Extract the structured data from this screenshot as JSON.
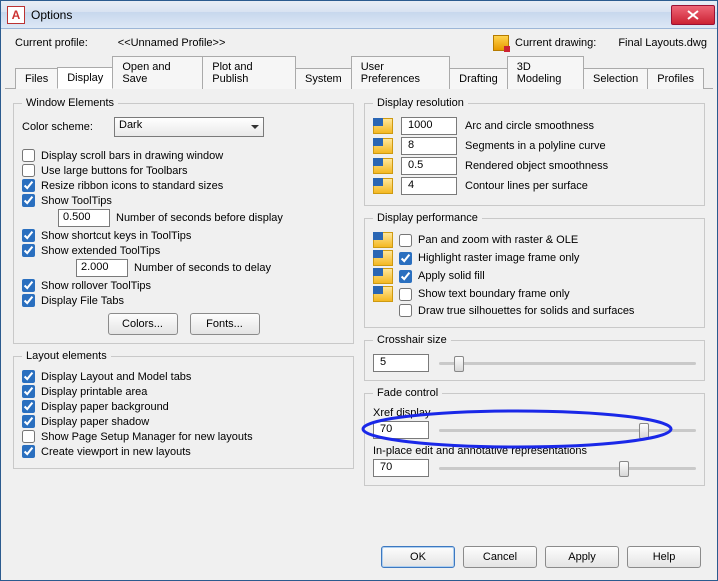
{
  "window": {
    "title": "Options"
  },
  "header": {
    "profile_label": "Current profile:",
    "profile_value": "<<Unnamed Profile>>",
    "drawing_label": "Current drawing:",
    "drawing_value": "Final Layouts.dwg"
  },
  "tabs": [
    "Files",
    "Display",
    "Open and Save",
    "Plot and Publish",
    "System",
    "User Preferences",
    "Drafting",
    "3D Modeling",
    "Selection",
    "Profiles"
  ],
  "active_tab": "Display",
  "window_elements": {
    "legend": "Window Elements",
    "color_scheme_label": "Color scheme:",
    "color_scheme_value": "Dark",
    "scrollbars": "Display scroll bars in drawing window",
    "large_buttons": "Use large buttons for Toolbars",
    "resize_ribbon": "Resize ribbon icons to standard sizes",
    "show_tooltips": "Show ToolTips",
    "seconds_before": "0.500",
    "seconds_before_label": "Number of seconds before display",
    "show_shortcut": "Show shortcut keys in ToolTips",
    "show_extended": "Show extended ToolTips",
    "seconds_delay": "2.000",
    "seconds_delay_label": "Number of seconds to delay",
    "show_rollover": "Show rollover ToolTips",
    "display_file_tabs": "Display File Tabs",
    "colors_btn": "Colors...",
    "fonts_btn": "Fonts..."
  },
  "layout_elements": {
    "legend": "Layout elements",
    "layout_model_tabs": "Display Layout and Model tabs",
    "printable_area": "Display printable area",
    "paper_bg": "Display paper background",
    "paper_shadow": "Display paper shadow",
    "page_setup_mgr": "Show Page Setup Manager for new layouts",
    "create_viewport": "Create viewport in new layouts"
  },
  "display_resolution": {
    "legend": "Display resolution",
    "arc": {
      "value": "1000",
      "label": "Arc and circle smoothness"
    },
    "segments": {
      "value": "8",
      "label": "Segments in a polyline curve"
    },
    "rendered": {
      "value": "0.5",
      "label": "Rendered object smoothness"
    },
    "contour": {
      "value": "4",
      "label": "Contour lines per surface"
    }
  },
  "display_performance": {
    "legend": "Display performance",
    "pan_zoom": "Pan and zoom with raster & OLE",
    "highlight_raster": "Highlight raster image frame only",
    "apply_solid": "Apply solid fill",
    "show_text_boundary": "Show text boundary frame only",
    "draw_silhouettes": "Draw true silhouettes for solids and surfaces"
  },
  "crosshair": {
    "legend": "Crosshair size",
    "value": "5"
  },
  "fade": {
    "legend": "Fade control",
    "xref_label": "Xref display",
    "xref_value": "70",
    "inplace_label": "In-place edit and annotative representations",
    "inplace_value": "70"
  },
  "footer": {
    "ok": "OK",
    "cancel": "Cancel",
    "apply": "Apply",
    "help": "Help"
  }
}
